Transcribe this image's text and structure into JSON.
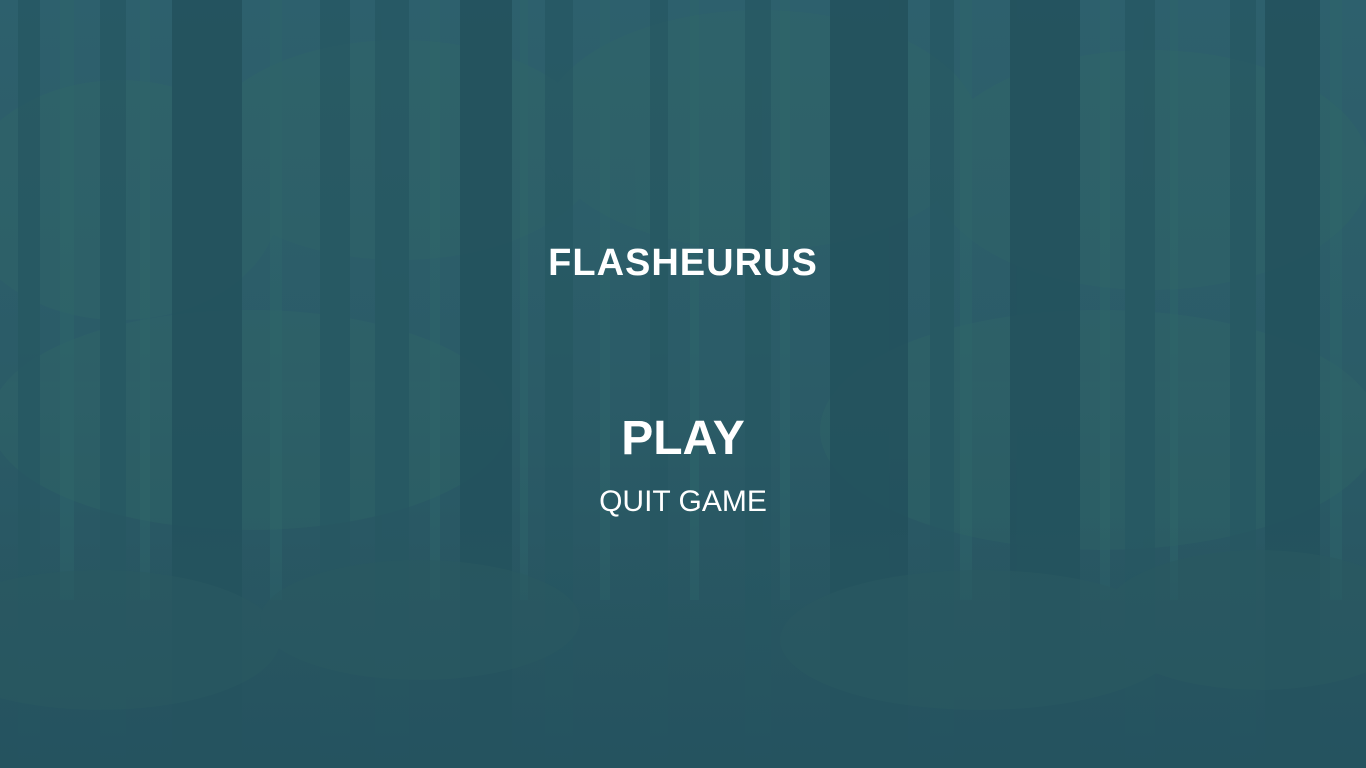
{
  "game": {
    "title": "FLASHEURUS"
  },
  "menu": {
    "play_label": "PLAY",
    "quit_label": "QUIT GAME"
  },
  "colors": {
    "overlay": "#2a5a66",
    "text": "#ffffff"
  },
  "background": {
    "scene": "forest-trees"
  }
}
